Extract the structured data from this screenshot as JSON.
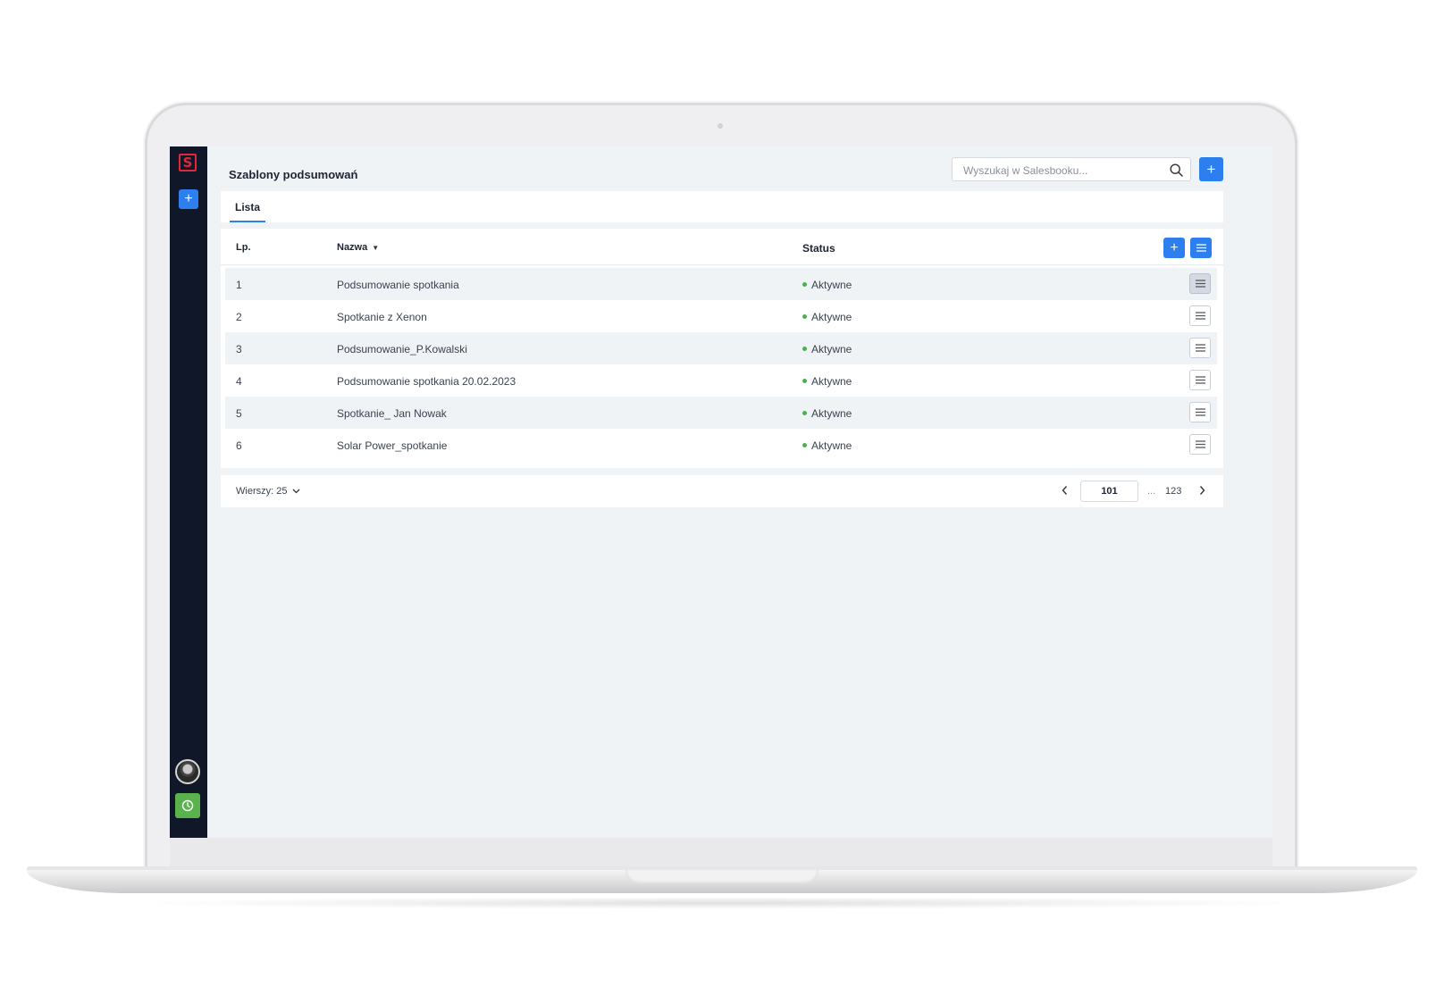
{
  "app": {
    "title": "Szablony podsumowań"
  },
  "search": {
    "placeholder": "Wyszukaj w Salesbooku..."
  },
  "tabs": [
    {
      "label": "Lista"
    }
  ],
  "table": {
    "columns": {
      "number": "Lp.",
      "name": "Nazwa",
      "status": "Status"
    },
    "rows": [
      {
        "lp": "1",
        "name": "Podsumowanie spotkania",
        "status": "Aktywne"
      },
      {
        "lp": "2",
        "name": "Spotkanie z Xenon",
        "status": "Aktywne"
      },
      {
        "lp": "3",
        "name": "Podsumowanie_P.Kowalski",
        "status": "Aktywne"
      },
      {
        "lp": "4",
        "name": "Podsumowanie spotkania 20.02.2023",
        "status": "Aktywne"
      },
      {
        "lp": "5",
        "name": "Spotkanie_ Jan Nowak",
        "status": "Aktywne"
      },
      {
        "lp": "6",
        "name": "Solar Power_spotkanie",
        "status": "Aktywne"
      }
    ]
  },
  "pagination": {
    "rows_label": "Wierszy: 25",
    "current_page": "101",
    "ellipsis": "...",
    "last_page": "123"
  },
  "icons": {
    "logo": "salesbook-logo",
    "add": "plus-icon",
    "search": "search-icon",
    "menu": "hamburger-icon",
    "clock": "clock-icon",
    "prev": "chevron-left-icon",
    "next": "chevron-right-icon",
    "dropdown": "chevron-down-icon"
  },
  "colors": {
    "accent": "#2d7ff0",
    "sidebar": "#101728",
    "logo": "#e0283a",
    "status_active": "#4caf50",
    "clock_button": "#5ab24d"
  }
}
